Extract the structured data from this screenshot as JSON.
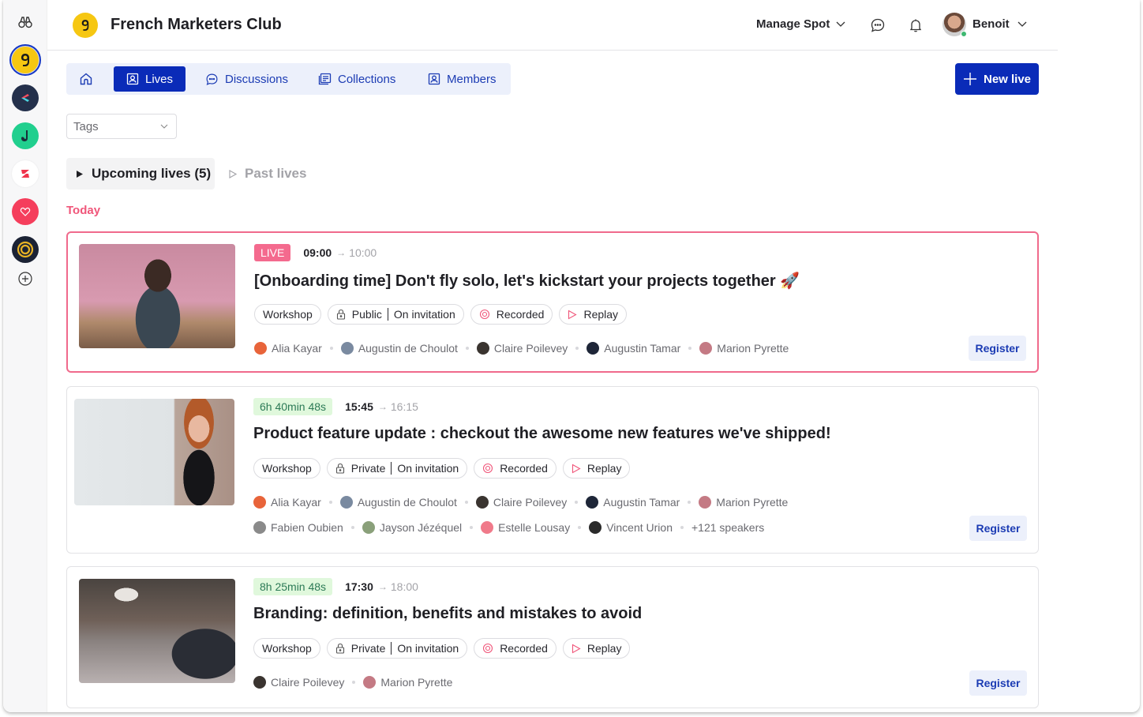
{
  "sidebar": {
    "spaces": [
      {
        "name": "French Marketers Club",
        "active": true,
        "color": "#f6c712"
      },
      {
        "name": "space-2",
        "color": "#24304b"
      },
      {
        "name": "space-3",
        "color": "#21cf8e"
      },
      {
        "name": "space-4",
        "color": "#ffffff"
      },
      {
        "name": "space-5",
        "color": "#f53e5c"
      },
      {
        "name": "space-6",
        "color": "#1b2234"
      }
    ],
    "top_icon": "binoculars-icon",
    "add_icon": "plus-circle-icon"
  },
  "header": {
    "club_title": "French Marketers Club",
    "manage_label": "Manage Spot",
    "user_name": "Benoit",
    "user_status": "online"
  },
  "tabs": {
    "home": "home-icon",
    "items": [
      {
        "label": "Lives",
        "active": true
      },
      {
        "label": "Discussions"
      },
      {
        "label": "Collections"
      },
      {
        "label": "Members"
      }
    ]
  },
  "actions": {
    "new_live": "New live"
  },
  "filters": {
    "tags_placeholder": "Tags"
  },
  "subtabs": {
    "upcoming": "Upcoming lives (5)",
    "past": "Past lives"
  },
  "section": {
    "today": "Today"
  },
  "colors": {
    "primary": "#0a2bb8",
    "live": "#f46a8e",
    "today": "#f0567a",
    "countdown_bg": "#e0f8dc",
    "countdown_text": "#2c7a56"
  },
  "lives": [
    {
      "status_badge": "LIVE",
      "start": "09:00",
      "end": "10:00",
      "title": "[Onboarding time] Don't fly solo, let's kickstart your projects together 🚀",
      "type": "Workshop",
      "visibility": "Public",
      "access": "On invitation",
      "recorded": "Recorded",
      "replay": "Replay",
      "speakers": [
        "Alia Kayar",
        "Augustin de Choulot",
        "Claire Poilevey",
        "Augustin Tamar",
        "Marion Pyrette"
      ],
      "register": "Register"
    },
    {
      "status_badge": "6h 40min 48s",
      "start": "15:45",
      "end": "16:15",
      "title": "Product feature update : checkout the awesome new features we've shipped!",
      "type": "Workshop",
      "visibility": "Private",
      "access": "On invitation",
      "recorded": "Recorded",
      "replay": "Replay",
      "speakers": [
        "Alia Kayar",
        "Augustin de Choulot",
        "Claire Poilevey",
        "Augustin Tamar",
        "Marion Pyrette"
      ],
      "speakers_row2": [
        "Fabien Oubien",
        "Jayson Jézéquel",
        "Estelle Lousay",
        "Vincent Urion"
      ],
      "more_speakers": "+121 speakers",
      "register": "Register"
    },
    {
      "status_badge": "8h 25min 48s",
      "start": "17:30",
      "end": "18:00",
      "title": "Branding: definition, benefits and mistakes to avoid",
      "type": "Workshop",
      "visibility": "Private",
      "access": "On invitation",
      "recorded": "Recorded",
      "replay": "Replay",
      "speakers": [
        "Claire Poilevey",
        "Marion Pyrette"
      ],
      "register": "Register"
    }
  ]
}
